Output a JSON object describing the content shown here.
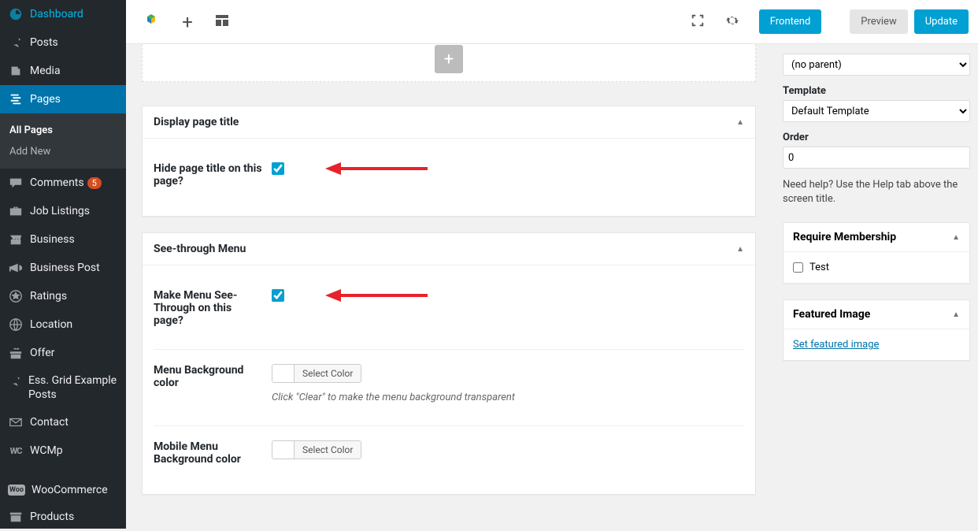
{
  "sidebar": {
    "dashboard": "Dashboard",
    "posts": "Posts",
    "media": "Media",
    "pages": "Pages",
    "pages_sub": {
      "all": "All Pages",
      "add": "Add New"
    },
    "comments": "Comments",
    "comments_count": "5",
    "job_listings": "Job Listings",
    "business": "Business",
    "business_post": "Business Post",
    "ratings": "Ratings",
    "location": "Location",
    "offer": "Offer",
    "ess_grid": "Ess. Grid Example Posts",
    "contact": "Contact",
    "wcmp": "WCMp",
    "woocommerce": "WooCommerce",
    "products": "Products"
  },
  "topbar": {
    "frontend": "Frontend",
    "preview": "Preview",
    "update": "Update"
  },
  "panels": {
    "display_title": {
      "heading": "Display page title",
      "hide_label": "Hide page title on this page?",
      "hide_checked": true
    },
    "see_through": {
      "heading": "See-through Menu",
      "make_label": "Make Menu See-Through on this page?",
      "make_checked": true,
      "menu_bg_label": "Menu Background color",
      "select_color": "Select Color",
      "menu_bg_note": "Click \"Clear\" to make the menu background transparent",
      "mobile_bg_label": "Mobile Menu Background color"
    }
  },
  "right": {
    "parent_options": "(no parent)",
    "template_label": "Template",
    "template_value": "Default Template",
    "order_label": "Order",
    "order_value": "0",
    "help_text": "Need help? Use the Help tab above the screen title.",
    "require_membership": "Require Membership",
    "test_label": "Test",
    "featured_image": "Featured Image",
    "set_featured": "Set featured image"
  }
}
